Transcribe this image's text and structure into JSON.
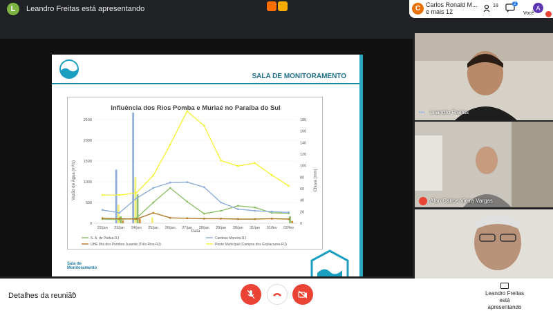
{
  "top": {
    "presenter_initial": "L",
    "presenter_text": "Leandro Freitas está apresentando",
    "participants_initial": "C",
    "participants_line1": "Carlos Ronald M...",
    "participants_line2": "e mais 12",
    "people_count": "18",
    "chat_count": "2",
    "self_initial": "A",
    "self_label": "Você"
  },
  "slide": {
    "header": "SALA DE MONITORAMENTO",
    "footer_logo_line1": "Sala de",
    "footer_logo_line2": "Monitoramento"
  },
  "chart_data": {
    "type": "bar",
    "title": "Influência dos Rios Pomba e Muriaé no Paraíba do Sul",
    "xlabel": "Data",
    "ylabel": "Vazão de Água (m³/s)",
    "y2label": "Chuva (mm)",
    "ylim": [
      0,
      2500
    ],
    "y2lim": [
      0,
      180
    ],
    "yticks": [
      "0",
      "500",
      "1000",
      "1500",
      "2000",
      "2500"
    ],
    "y2ticks": [
      "0",
      "20",
      "40",
      "60",
      "80",
      "100",
      "120",
      "140",
      "160",
      "180"
    ],
    "categories": [
      "22/jan",
      "23/jan",
      "24/jan",
      "25/jan",
      "26/jan",
      "27/jan",
      "28/jan",
      "29/jan",
      "30/jan",
      "31/jan",
      "01/fev",
      "02/fev"
    ],
    "bars": [
      {
        "color": "#8fadd9",
        "values": [
          0,
          93,
          192,
          0,
          0,
          0,
          0,
          0,
          0,
          0,
          0,
          0
        ]
      },
      {
        "color": "#f2f27a",
        "values": [
          0,
          32,
          80,
          10,
          0,
          0,
          0,
          0,
          0,
          0,
          0,
          0
        ]
      },
      {
        "color": "#8fbf6a",
        "values": [
          0,
          12,
          50,
          0,
          0,
          0,
          0,
          0,
          0,
          0,
          0,
          12
        ]
      },
      {
        "color": "#c8903a",
        "values": [
          0,
          5,
          8,
          0,
          0,
          0,
          0,
          0,
          0,
          0,
          0,
          4
        ]
      }
    ],
    "series": [
      {
        "name": "S. A. de Pádua-RJ",
        "color": "#8fbf6a",
        "values": [
          100,
          90,
          120,
          500,
          850,
          520,
          230,
          300,
          420,
          380,
          250,
          240
        ]
      },
      {
        "name": "Cardoso Moreira-RJ",
        "color": "#8fadd9",
        "values": [
          320,
          250,
          600,
          850,
          980,
          990,
          870,
          500,
          340,
          300,
          280,
          260
        ]
      },
      {
        "name": "UHE Ilha dos Pombos Jusante (Três Rios-RJ)",
        "color": "#b07a2a",
        "values": [
          120,
          110,
          100,
          250,
          130,
          120,
          110,
          110,
          100,
          100,
          110,
          100
        ]
      },
      {
        "name": "Ponte Municipal (Campos dos Goytacazes-RJ)",
        "color": "#f5f23a",
        "values": [
          680,
          680,
          730,
          1150,
          1900,
          2700,
          2350,
          1510,
          1380,
          1450,
          1160,
          900
        ]
      }
    ],
    "legend_position": "bottom"
  },
  "tiles": [
    {
      "name": "Leandro Freitas",
      "dots": "•••"
    },
    {
      "name": "Alan Carlos Vieira Vargas"
    },
    {
      "name": ""
    }
  ],
  "bottom": {
    "details_label": "Detalhes da reunião",
    "present_line1": "Leandro Freitas",
    "present_line2": "está apresentando"
  }
}
